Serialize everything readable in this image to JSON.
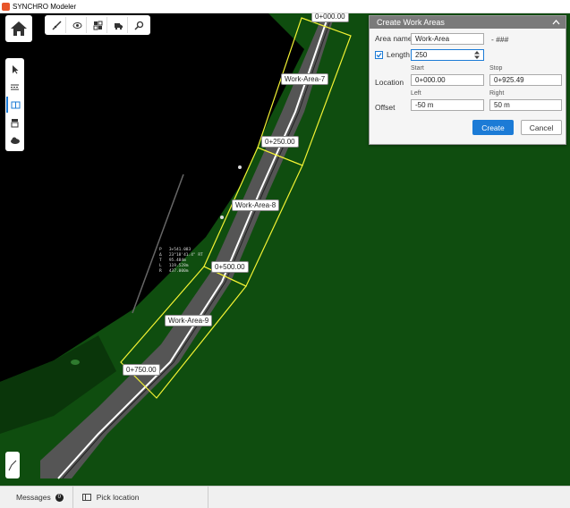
{
  "app": {
    "title": "SYNCHRO Modeler"
  },
  "toolbar": {
    "icons": [
      "ruler-icon",
      "visibility-icon",
      "grid-icon",
      "truck-icon",
      "search-icon"
    ]
  },
  "side_toolbar": {
    "icons": [
      "cursor-icon",
      "road-icon",
      "split-icon",
      "layer-icon",
      "cloud-icon"
    ]
  },
  "map": {
    "stations": [
      "0+000.00",
      "0+250.00",
      "0+500.00",
      "0+750.00"
    ],
    "work_areas": [
      "Work-Area-7",
      "Work-Area-8",
      "Work-Area-9"
    ],
    "survey_lines": [
      "P   3+541.083",
      "Δ   23°18'41.4\" RT",
      "T   95.484m",
      "L   119.528m",
      "R   437.000m"
    ]
  },
  "panel": {
    "title": "Create Work Areas",
    "name_label": "Area name",
    "name_value": "Work-Area",
    "name_suffix": "- ###",
    "length_label": "Length",
    "length_checked": true,
    "length_value": "250",
    "location_label": "Location",
    "start_label": "Start",
    "stop_label": "Stop",
    "start_value": "0+000.00",
    "stop_value": "0+925.49",
    "offset_label": "Offset",
    "left_label": "Left",
    "right_label": "Right",
    "left_value": "-50 m",
    "right_value": "50 m",
    "create_label": "Create",
    "cancel_label": "Cancel"
  },
  "status": {
    "messages_label": "Messages",
    "messages_count": "0",
    "pick_label": "Pick location"
  },
  "colors": {
    "accent": "#1c7bd6",
    "terrain": "#0f4d0f",
    "outline": "#f2f233",
    "road": "#555555"
  }
}
